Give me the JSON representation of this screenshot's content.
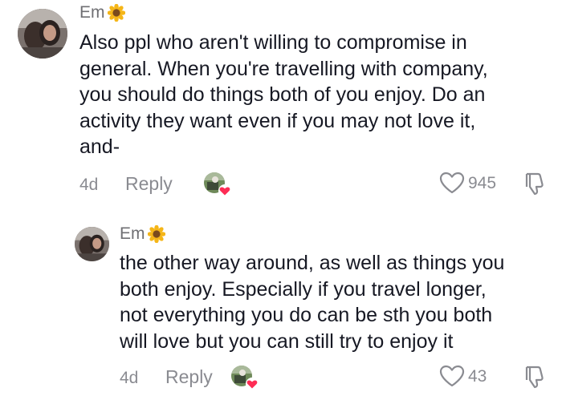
{
  "comments": [
    {
      "username": "Em",
      "badge_emoji": "sunflower",
      "text_lines": [
        "Also ppl who aren't willing to compromise in",
        "general. When you're travelling with company,",
        "you should do things both of you enjoy. Do an",
        "activity they want even if you may not love it,",
        "and-"
      ],
      "age": "4d",
      "reply_label": "Reply",
      "likes": "945"
    },
    {
      "username": "Em",
      "badge_emoji": "sunflower",
      "text_lines": [
        "the other way around, as well as things you",
        "both enjoy. Especially if you travel longer,",
        "not everything you do can be sth you both",
        "will love but you can still try to enjoy it"
      ],
      "age": "4d",
      "reply_label": "Reply",
      "likes": "43"
    }
  ],
  "colors": {
    "text": "#161823",
    "muted": "#8a8b91",
    "heart": "#fe2c55"
  },
  "icons": {
    "like": "heart-outline-icon",
    "dislike": "thumbs-down-outline-icon",
    "creator_liked": "creator-liked-heart-icon",
    "badge": "sunflower-icon"
  }
}
